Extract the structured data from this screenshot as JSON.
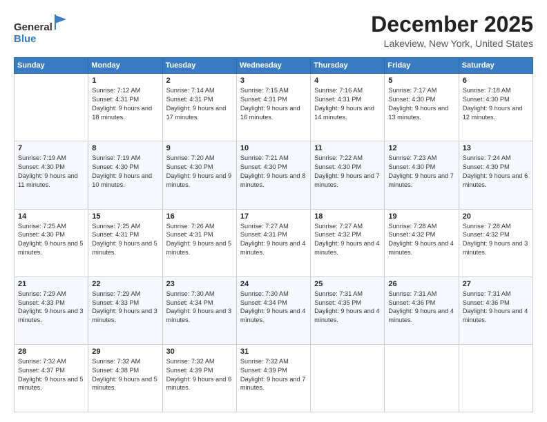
{
  "header": {
    "logo": {
      "general": "General",
      "blue": "Blue"
    },
    "title": "December 2025",
    "subtitle": "Lakeview, New York, United States"
  },
  "days_of_week": [
    "Sunday",
    "Monday",
    "Tuesday",
    "Wednesday",
    "Thursday",
    "Friday",
    "Saturday"
  ],
  "weeks": [
    [
      null,
      {
        "day": 1,
        "sunrise": "Sunrise: 7:12 AM",
        "sunset": "Sunset: 4:31 PM",
        "daylight": "Daylight: 9 hours and 18 minutes."
      },
      {
        "day": 2,
        "sunrise": "Sunrise: 7:14 AM",
        "sunset": "Sunset: 4:31 PM",
        "daylight": "Daylight: 9 hours and 17 minutes."
      },
      {
        "day": 3,
        "sunrise": "Sunrise: 7:15 AM",
        "sunset": "Sunset: 4:31 PM",
        "daylight": "Daylight: 9 hours and 16 minutes."
      },
      {
        "day": 4,
        "sunrise": "Sunrise: 7:16 AM",
        "sunset": "Sunset: 4:31 PM",
        "daylight": "Daylight: 9 hours and 14 minutes."
      },
      {
        "day": 5,
        "sunrise": "Sunrise: 7:17 AM",
        "sunset": "Sunset: 4:30 PM",
        "daylight": "Daylight: 9 hours and 13 minutes."
      },
      {
        "day": 6,
        "sunrise": "Sunrise: 7:18 AM",
        "sunset": "Sunset: 4:30 PM",
        "daylight": "Daylight: 9 hours and 12 minutes."
      }
    ],
    [
      {
        "day": 7,
        "sunrise": "Sunrise: 7:19 AM",
        "sunset": "Sunset: 4:30 PM",
        "daylight": "Daylight: 9 hours and 11 minutes."
      },
      {
        "day": 8,
        "sunrise": "Sunrise: 7:19 AM",
        "sunset": "Sunset: 4:30 PM",
        "daylight": "Daylight: 9 hours and 10 minutes."
      },
      {
        "day": 9,
        "sunrise": "Sunrise: 7:20 AM",
        "sunset": "Sunset: 4:30 PM",
        "daylight": "Daylight: 9 hours and 9 minutes."
      },
      {
        "day": 10,
        "sunrise": "Sunrise: 7:21 AM",
        "sunset": "Sunset: 4:30 PM",
        "daylight": "Daylight: 9 hours and 8 minutes."
      },
      {
        "day": 11,
        "sunrise": "Sunrise: 7:22 AM",
        "sunset": "Sunset: 4:30 PM",
        "daylight": "Daylight: 9 hours and 7 minutes."
      },
      {
        "day": 12,
        "sunrise": "Sunrise: 7:23 AM",
        "sunset": "Sunset: 4:30 PM",
        "daylight": "Daylight: 9 hours and 7 minutes."
      },
      {
        "day": 13,
        "sunrise": "Sunrise: 7:24 AM",
        "sunset": "Sunset: 4:30 PM",
        "daylight": "Daylight: 9 hours and 6 minutes."
      }
    ],
    [
      {
        "day": 14,
        "sunrise": "Sunrise: 7:25 AM",
        "sunset": "Sunset: 4:30 PM",
        "daylight": "Daylight: 9 hours and 5 minutes."
      },
      {
        "day": 15,
        "sunrise": "Sunrise: 7:25 AM",
        "sunset": "Sunset: 4:31 PM",
        "daylight": "Daylight: 9 hours and 5 minutes."
      },
      {
        "day": 16,
        "sunrise": "Sunrise: 7:26 AM",
        "sunset": "Sunset: 4:31 PM",
        "daylight": "Daylight: 9 hours and 5 minutes."
      },
      {
        "day": 17,
        "sunrise": "Sunrise: 7:27 AM",
        "sunset": "Sunset: 4:31 PM",
        "daylight": "Daylight: 9 hours and 4 minutes."
      },
      {
        "day": 18,
        "sunrise": "Sunrise: 7:27 AM",
        "sunset": "Sunset: 4:32 PM",
        "daylight": "Daylight: 9 hours and 4 minutes."
      },
      {
        "day": 19,
        "sunrise": "Sunrise: 7:28 AM",
        "sunset": "Sunset: 4:32 PM",
        "daylight": "Daylight: 9 hours and 4 minutes."
      },
      {
        "day": 20,
        "sunrise": "Sunrise: 7:28 AM",
        "sunset": "Sunset: 4:32 PM",
        "daylight": "Daylight: 9 hours and 3 minutes."
      }
    ],
    [
      {
        "day": 21,
        "sunrise": "Sunrise: 7:29 AM",
        "sunset": "Sunset: 4:33 PM",
        "daylight": "Daylight: 9 hours and 3 minutes."
      },
      {
        "day": 22,
        "sunrise": "Sunrise: 7:29 AM",
        "sunset": "Sunset: 4:33 PM",
        "daylight": "Daylight: 9 hours and 3 minutes."
      },
      {
        "day": 23,
        "sunrise": "Sunrise: 7:30 AM",
        "sunset": "Sunset: 4:34 PM",
        "daylight": "Daylight: 9 hours and 3 minutes."
      },
      {
        "day": 24,
        "sunrise": "Sunrise: 7:30 AM",
        "sunset": "Sunset: 4:34 PM",
        "daylight": "Daylight: 9 hours and 4 minutes."
      },
      {
        "day": 25,
        "sunrise": "Sunrise: 7:31 AM",
        "sunset": "Sunset: 4:35 PM",
        "daylight": "Daylight: 9 hours and 4 minutes."
      },
      {
        "day": 26,
        "sunrise": "Sunrise: 7:31 AM",
        "sunset": "Sunset: 4:36 PM",
        "daylight": "Daylight: 9 hours and 4 minutes."
      },
      {
        "day": 27,
        "sunrise": "Sunrise: 7:31 AM",
        "sunset": "Sunset: 4:36 PM",
        "daylight": "Daylight: 9 hours and 4 minutes."
      }
    ],
    [
      {
        "day": 28,
        "sunrise": "Sunrise: 7:32 AM",
        "sunset": "Sunset: 4:37 PM",
        "daylight": "Daylight: 9 hours and 5 minutes."
      },
      {
        "day": 29,
        "sunrise": "Sunrise: 7:32 AM",
        "sunset": "Sunset: 4:38 PM",
        "daylight": "Daylight: 9 hours and 5 minutes."
      },
      {
        "day": 30,
        "sunrise": "Sunrise: 7:32 AM",
        "sunset": "Sunset: 4:39 PM",
        "daylight": "Daylight: 9 hours and 6 minutes."
      },
      {
        "day": 31,
        "sunrise": "Sunrise: 7:32 AM",
        "sunset": "Sunset: 4:39 PM",
        "daylight": "Daylight: 9 hours and 7 minutes."
      },
      null,
      null,
      null
    ]
  ]
}
